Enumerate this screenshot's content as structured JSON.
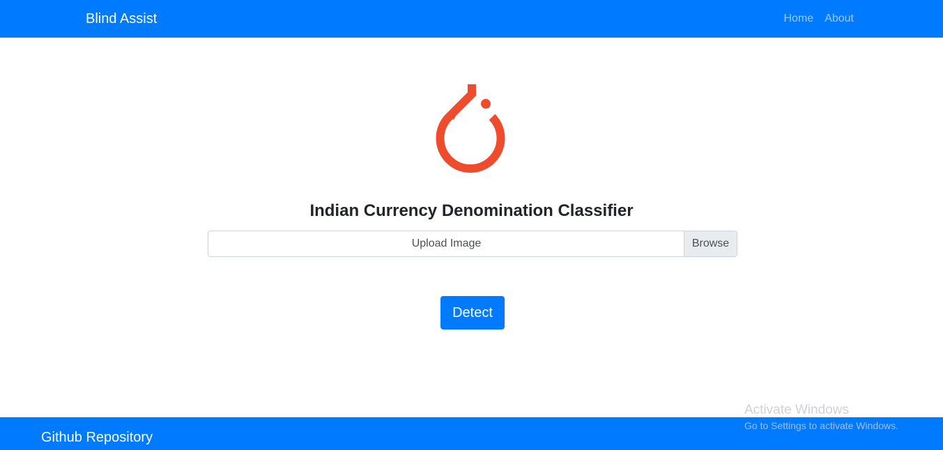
{
  "navbar": {
    "brand": "Blind Assist",
    "links": [
      {
        "label": "Home"
      },
      {
        "label": "About"
      }
    ],
    "bg_color": "#007bff"
  },
  "logo": {
    "icon": "pytorch-flame-icon",
    "color": "#ee4c2c"
  },
  "main": {
    "title": "Indian Currency Denomination Classifier",
    "file_input": {
      "label": "Upload Image",
      "button_label": "Browse"
    },
    "detect_label": "Detect"
  },
  "footer": {
    "link_label": "Github Repository"
  },
  "watermark": {
    "title": "Activate Windows",
    "subtitle": "Go to Settings to activate Windows."
  }
}
